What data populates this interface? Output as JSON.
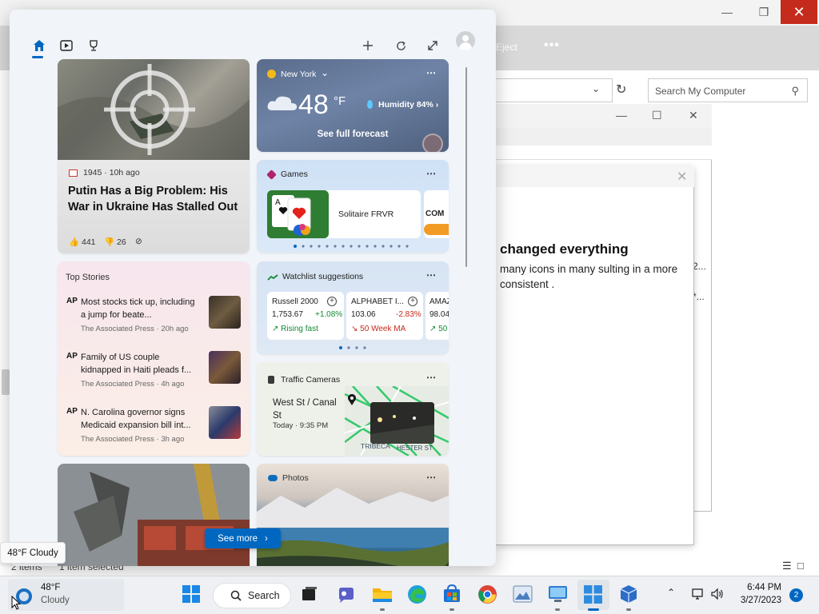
{
  "background_window": {
    "ribbon_button": "Eject",
    "search_placeholder": "Search My Computer",
    "dialog_heading": "changed everything",
    "dialog_body": "many icons in many sulting in a more consistent .",
    "side_text_1": "2...",
    "side_text_2": "*...",
    "status_items": "2 items",
    "status_selected": "1 item selected"
  },
  "widgets": {
    "nav": [
      "home-icon",
      "video-icon",
      "sports-icon"
    ],
    "header_actions": [
      "add-icon",
      "refresh-icon",
      "expand-icon",
      "avatar"
    ],
    "news_card": {
      "source": "1945",
      "age": "10h ago",
      "title": "Putin Has a Big Problem: His War in Ukraine Has Stalled Out",
      "likes": "441",
      "dislikes": "26"
    },
    "weather": {
      "city": "New York",
      "temp": "48",
      "unit": "°F",
      "humidity": "Humidity 84%",
      "link": "See full forecast"
    },
    "games": {
      "title": "Games",
      "game_name": "Solitaire FRVR",
      "peek_text": "COM"
    },
    "top_stories": {
      "title": "Top Stories",
      "items": [
        {
          "badge": "AP",
          "headline": "Most stocks tick up, including a jump for beate...",
          "source": "The Associated Press",
          "age": "20h ago"
        },
        {
          "badge": "AP",
          "headline": "Family of US couple kidnapped in Haiti pleads f...",
          "source": "The Associated Press",
          "age": "4h ago"
        },
        {
          "badge": "AP",
          "headline": "N. Carolina governor signs Medicaid expansion bill int...",
          "source": "The Associated Press",
          "age": "3h ago"
        }
      ]
    },
    "watchlist": {
      "title": "Watchlist suggestions",
      "stocks": [
        {
          "name": "Russell 2000",
          "price": "1,753.67",
          "change": "+1.08%",
          "tag": "Rising fast",
          "direction": "up"
        },
        {
          "name": "ALPHABET I...",
          "price": "103.06",
          "change": "-2.83%",
          "tag": "50 Week MA",
          "direction": "down"
        },
        {
          "name": "AMAZ",
          "price": "98.04",
          "change": "",
          "tag": "50",
          "direction": "up"
        }
      ]
    },
    "traffic": {
      "title": "Traffic Cameras",
      "location": "West St / Canal St",
      "time": "Today · 9:35 PM",
      "map_label_1": "TRIBECA",
      "map_label_2": "HESTER ST"
    },
    "photos": {
      "title": "Photos"
    },
    "see_more": "See more"
  },
  "tooltip": "48°F Cloudy",
  "taskbar": {
    "weather_temp": "48°F",
    "weather_cond": "Cloudy",
    "search_label": "Search",
    "clock_time": "6:44 PM",
    "clock_date": "3/27/2023",
    "notification_count": "2"
  },
  "colors": {
    "accent": "#0067c0",
    "close_red": "#c42b1c",
    "stock_up": "#138a36",
    "stock_down": "#c42b1c"
  }
}
